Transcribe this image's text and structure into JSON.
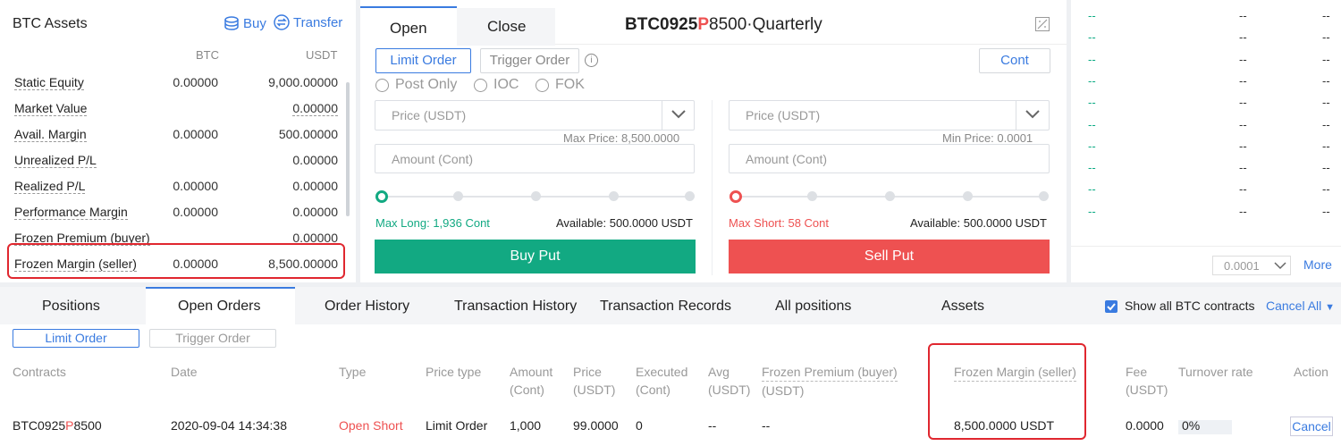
{
  "assets": {
    "title": "BTC Assets",
    "buy": "Buy",
    "transfer": "Transfer",
    "col_btc": "BTC",
    "col_usdt": "USDT",
    "rows": [
      {
        "label": "Static Equity",
        "btc": "0.00000",
        "usdt": "9,000.00000"
      },
      {
        "label": "Market Value",
        "btc": "",
        "usdt": "0.00000"
      },
      {
        "label": "Avail. Margin",
        "btc": "0.00000",
        "usdt": "500.00000"
      },
      {
        "label": "Unrealized P/L",
        "btc": "",
        "usdt": "0.00000"
      },
      {
        "label": "Realized P/L",
        "btc": "0.00000",
        "usdt": "0.00000"
      },
      {
        "label": "Performance Margin",
        "btc": "0.00000",
        "usdt": "0.00000"
      },
      {
        "label": "Frozen Premium (buyer)",
        "btc": "",
        "usdt": "0.00000"
      },
      {
        "label": "Frozen Margin (seller)",
        "btc": "0.00000",
        "usdt": "8,500.00000"
      }
    ]
  },
  "order": {
    "tab_open": "Open",
    "tab_close": "Close",
    "contract_prefix": "BTC0925",
    "contract_p": "P",
    "contract_suffix": "8500·Quarterly",
    "limit_order": "Limit Order",
    "trigger_order": "Trigger Order",
    "cont": "Cont",
    "post_only": "Post Only",
    "ioc": "IOC",
    "fok": "FOK",
    "price_placeholder": "Price (USDT)",
    "amount_placeholder": "Amount (Cont)",
    "max_price": "Max Price:  8,500.0000",
    "min_price": "Min Price:  0.0001",
    "max_long": "Max Long: 1,936 Cont",
    "max_short": "Max Short: 58 Cont",
    "available_left": "Available: 500.0000 USDT",
    "available_right": "Available: 500.0000 USDT",
    "buy_put": "Buy Put",
    "sell_put": "Sell Put",
    "colors": {
      "green": "#12a982",
      "red": "#ee5151"
    }
  },
  "book": {
    "rows": 10,
    "dash": "--",
    "precision": "0.0001",
    "more": "More"
  },
  "bottom": {
    "tabs": [
      "Positions",
      "Open Orders",
      "Order History",
      "Transaction History",
      "Transaction Records",
      "All positions",
      "Assets"
    ],
    "show_all": "Show all BTC contracts",
    "cancel_all": "Cancel All",
    "sub_limit": "Limit Order",
    "sub_trigger": "Trigger Order",
    "headers": {
      "contracts": "Contracts",
      "date": "Date",
      "type": "Type",
      "price_type": "Price type",
      "amount1": "Amount",
      "amount2": "(Cont)",
      "price1": "Price",
      "price2": "(USDT)",
      "executed1": "Executed",
      "executed2": "(Cont)",
      "avg1": "Avg",
      "avg2": "(USDT)",
      "fpb1": "Frozen Premium (buyer)",
      "fpb2": "(USDT)",
      "fms": "Frozen Margin (seller)",
      "fee1": "Fee",
      "fee2": "(USDT)",
      "turnover": "Turnover rate",
      "action": "Action"
    },
    "row": {
      "contract_prefix": "BTC0925",
      "contract_p": "P",
      "contract_suffix": "8500",
      "date": "2020-09-04 14:34:38",
      "type": "Open Short",
      "price_type": "Limit Order",
      "amount": "1,000",
      "price": "99.0000",
      "executed": "0",
      "avg": "--",
      "fpb": "--",
      "fms": "8,500.0000 USDT",
      "fee": "0.0000",
      "turnover": "0%",
      "action": "Cancel"
    }
  }
}
